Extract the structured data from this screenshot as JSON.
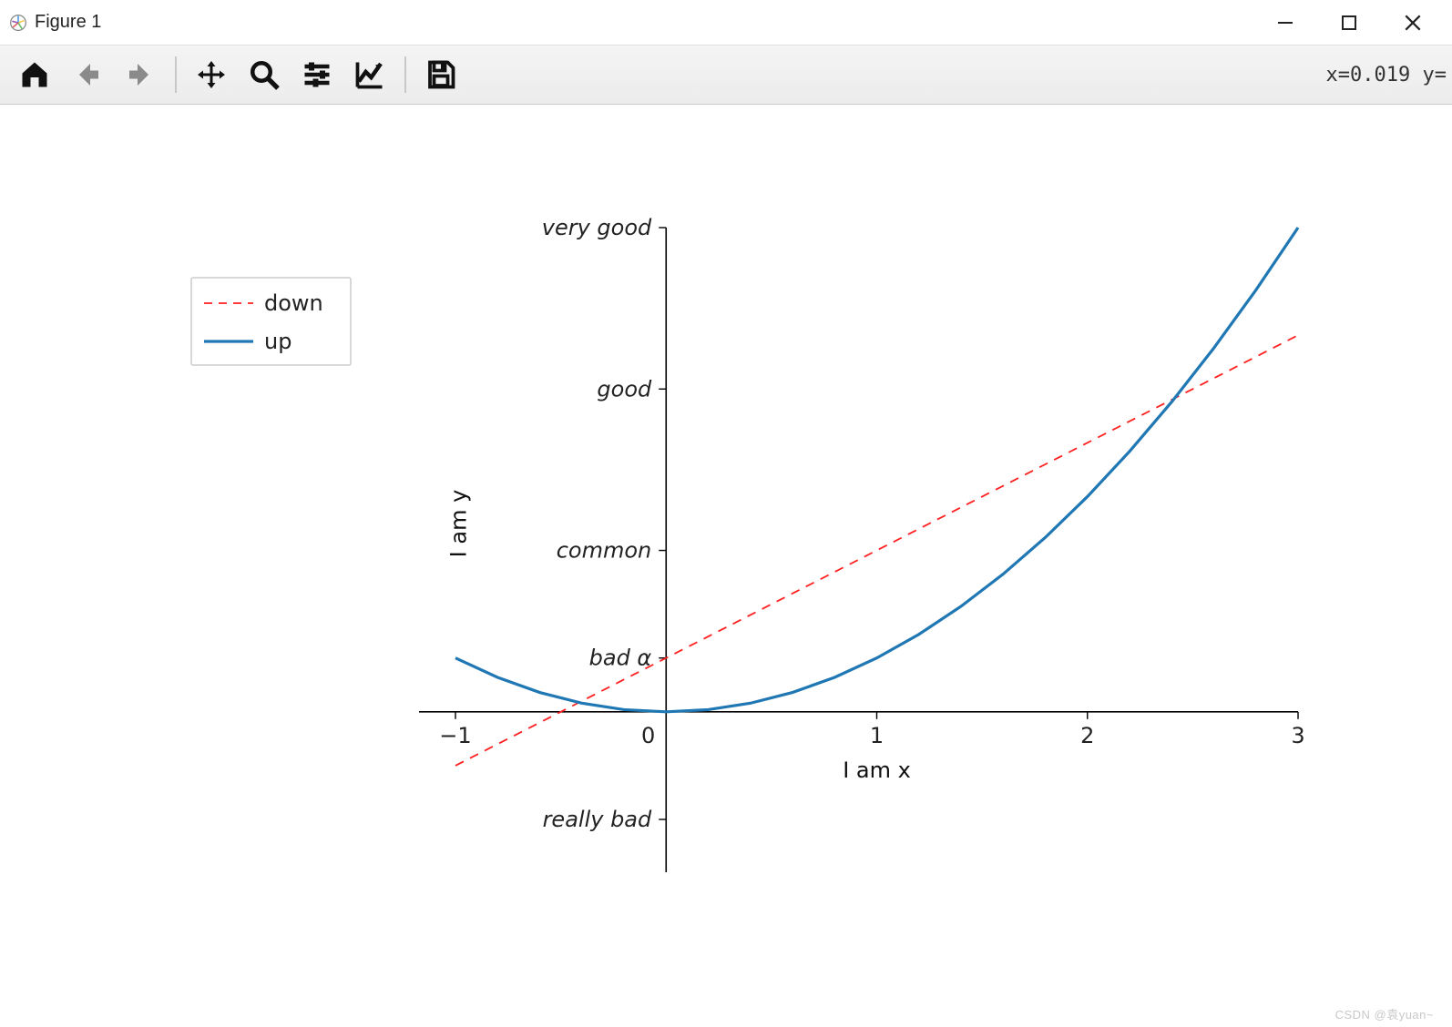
{
  "window": {
    "title": "Figure 1",
    "coord_readout": "x=0.019 y="
  },
  "toolbar": {
    "home": "Home",
    "back": "Back",
    "forward": "Forward",
    "pan": "Pan",
    "zoom": "Zoom",
    "configure": "Configure subplots",
    "edit": "Edit axis",
    "save": "Save"
  },
  "legend": {
    "items": [
      {
        "label": "down",
        "color": "#ff2020",
        "dash": true
      },
      {
        "label": "up",
        "color": "#1f77b4",
        "dash": false
      }
    ]
  },
  "watermark": "CSDN @袁yuan~",
  "chart_data": {
    "type": "line",
    "xlabel": "I am x",
    "ylabel": "I am y",
    "xlim": [
      -1,
      3
    ],
    "ylim": [
      -2,
      9
    ],
    "x_ticks": [
      -1,
      0,
      1,
      2,
      3
    ],
    "y_ticks": {
      "positions": [
        -2,
        1,
        3,
        6,
        9
      ],
      "labels": [
        "really bad",
        "bad α",
        "common",
        "good",
        "very good"
      ]
    },
    "x": [
      -1.0,
      -0.8,
      -0.6,
      -0.4,
      -0.2,
      0.0,
      0.2,
      0.4,
      0.6,
      0.8,
      1.0,
      1.2,
      1.4,
      1.6,
      1.8,
      2.0,
      2.2,
      2.4,
      2.6,
      2.8,
      3.0
    ],
    "series": [
      {
        "name": "down",
        "color": "#ff2020",
        "dash": true,
        "values": [
          -1.0,
          -0.6,
          -0.2,
          0.2,
          0.6,
          1.0,
          1.4,
          1.8,
          2.2,
          2.6,
          3.0,
          3.4,
          3.8,
          4.2,
          4.6,
          5.0,
          5.4,
          5.8,
          6.2,
          6.6,
          7.0
        ]
      },
      {
        "name": "up",
        "color": "#1f77b4",
        "dash": false,
        "values": [
          1.0,
          0.64,
          0.36,
          0.16,
          0.04,
          0.0,
          0.04,
          0.16,
          0.36,
          0.64,
          1.0,
          1.44,
          1.96,
          2.56,
          3.24,
          4.0,
          4.84,
          5.76,
          6.76,
          7.84,
          9.0
        ]
      }
    ]
  }
}
